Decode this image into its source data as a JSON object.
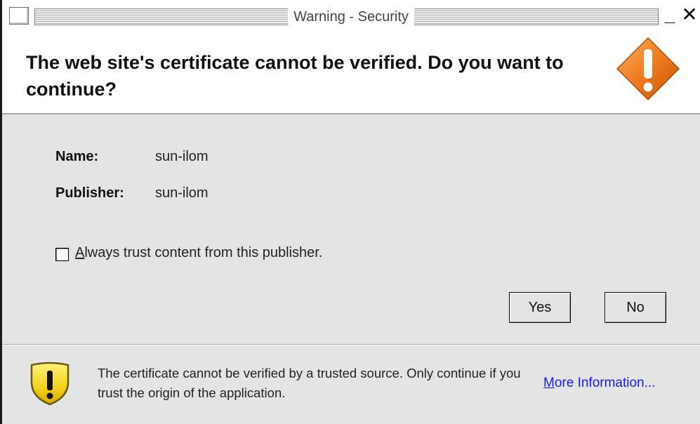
{
  "window": {
    "title": "Warning - Security",
    "minimize_glyph": "_",
    "close_glyph": "✕"
  },
  "header": {
    "message": "The web site's certificate cannot be verified.  Do you want to continue?",
    "icon": "warning-diamond-icon",
    "icon_color": "#f07a1e"
  },
  "details": {
    "name_label": "Name:",
    "name_value": "sun-ilom",
    "publisher_label": "Publisher:",
    "publisher_value": "sun-ilom"
  },
  "trust_checkbox": {
    "checked": false,
    "mnemonic": "A",
    "label_rest": "lways trust content from this publisher."
  },
  "buttons": {
    "yes_label": "Yes",
    "no_label": "No"
  },
  "footer": {
    "icon": "warning-shield-icon",
    "icon_color": "#f2d21a",
    "message": "The certificate cannot be verified by a trusted source.  Only continue if you trust the origin of the application.",
    "link_mnemonic": "M",
    "link_rest": "ore Information...",
    "link_color": "#1a1aee"
  }
}
